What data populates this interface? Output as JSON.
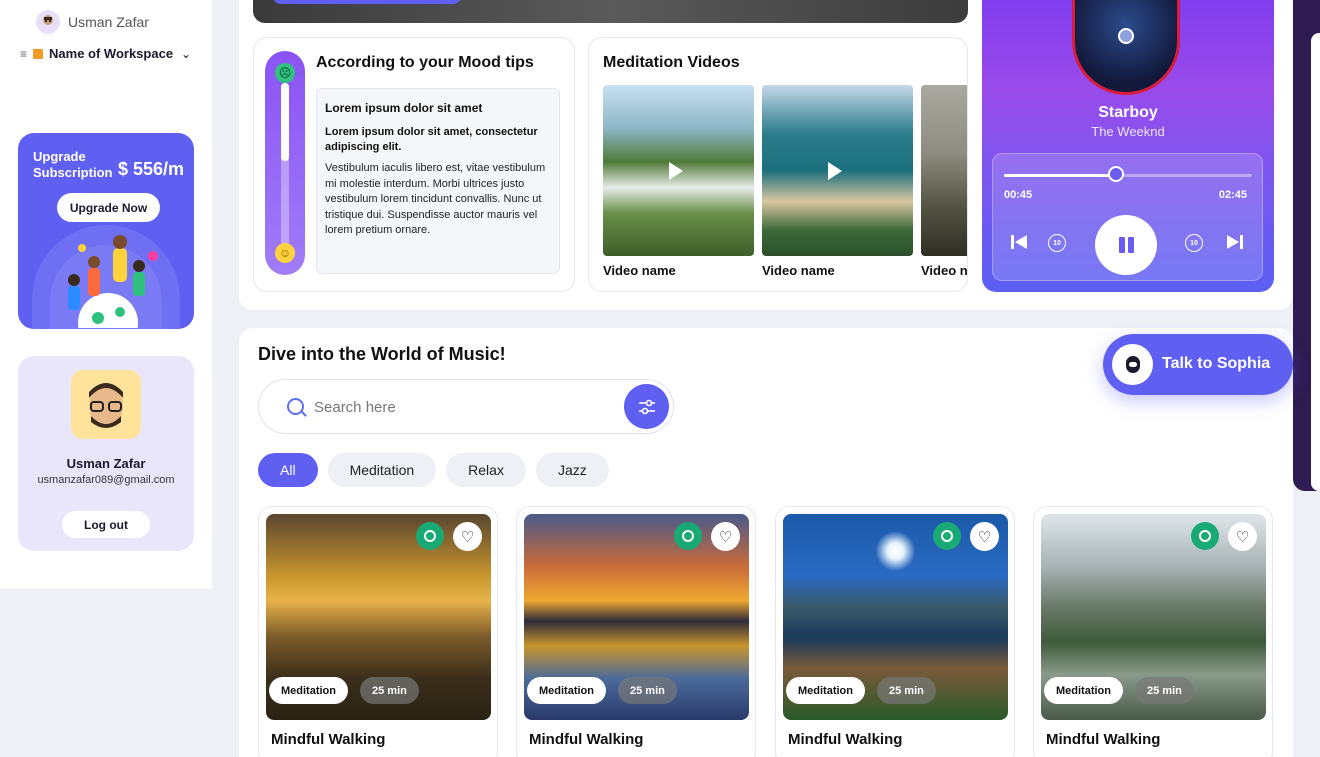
{
  "user": {
    "name": "Usman Zafar",
    "email": "usmanzafar089@gmail.com"
  },
  "workspace": {
    "name": "Name of Workspace"
  },
  "upgrade": {
    "title": "Upgrade Subscription",
    "price": "$ 556/m",
    "button": "Upgrade Now"
  },
  "profile": {
    "logout": "Log out"
  },
  "mood": {
    "title": "According to your Mood tips",
    "tip_heading": "Lorem ipsum dolor sit amet",
    "tip_sub": "Lorem ipsum dolor sit amet, consectetur adipiscing elit.",
    "tip_body": "Vestibulum iaculis libero est, vitae vestibulum mi molestie interdum. Morbi ultrices justo vestibulum lorem tincidunt convallis. Nunc ut tristique dui. Suspendisse auctor mauris vel lorem pretium ornare."
  },
  "videos": {
    "title": "Meditation Videos",
    "items": [
      {
        "name": "Video name"
      },
      {
        "name": "Video name"
      },
      {
        "name": "Video n"
      }
    ]
  },
  "player": {
    "song": "Starboy",
    "artist": "The Weeknd",
    "elapsed": "00:45",
    "total": "02:45",
    "progress": 0.45,
    "skip_back": "10",
    "skip_forward": "10"
  },
  "music": {
    "title": "Dive into the World of Music!",
    "search_placeholder": "Search here",
    "chips": [
      "All",
      "Meditation",
      "Relax",
      "Jazz"
    ],
    "cards": [
      {
        "title": "Mindful Walking",
        "tag": "Meditation",
        "duration": "25 min"
      },
      {
        "title": "Mindful Walking",
        "tag": "Meditation",
        "duration": "25 min"
      },
      {
        "title": "Mindful Walking",
        "tag": "Meditation",
        "duration": "25 min"
      },
      {
        "title": "Mindful Walking",
        "tag": "Meditation",
        "duration": "25 min"
      }
    ]
  },
  "assistant": {
    "label": "Talk to Sophia"
  },
  "colors": {
    "accent": "#5f5ff2",
    "green": "#19a974",
    "player_top": "#7c3cf0"
  },
  "icons": [
    "menu-icon",
    "chevron-down-icon",
    "search-icon",
    "filter-icon",
    "heart-icon",
    "play-icon",
    "pause-icon",
    "skip-previous-icon",
    "skip-next-icon",
    "rewind-10-icon",
    "forward-10-icon",
    "mood-sad-icon",
    "mood-happy-icon",
    "bot-icon"
  ]
}
